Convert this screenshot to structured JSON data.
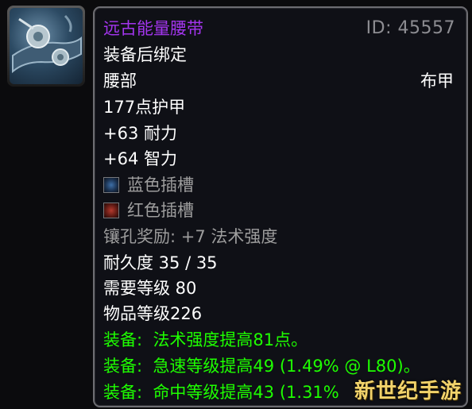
{
  "item": {
    "name": "远古能量腰带",
    "id_text": "ID: 45557",
    "binding": "装备后绑定",
    "slot": "腰部",
    "armor_type": "布甲",
    "armor": "177点护甲",
    "stats": [
      "+63 耐力",
      "+64 智力"
    ],
    "sockets": [
      {
        "color": "blue",
        "label": "蓝色插槽"
      },
      {
        "color": "red",
        "label": "红色插槽"
      }
    ],
    "socket_bonus": "镶孔奖励: +7 法术强度",
    "durability": "耐久度 35 / 35",
    "required_level": "需要等级 80",
    "item_level": "物品等级226",
    "equip_effects": [
      {
        "prefix": "装备:",
        "text": "法术强度提高81点。"
      },
      {
        "prefix": "装备:",
        "text": "急速等级提高49 (1.49% @ L80)。"
      },
      {
        "prefix": "装备:",
        "text": "命中等级提高43 (1.31%"
      }
    ]
  },
  "watermark": "新世纪手游",
  "colors": {
    "epic": "#a335ee",
    "green": "#1eff00",
    "gray": "#9d9d9d",
    "id_gray": "#8d8d92",
    "white": "#ffffff",
    "background": "#0f1016"
  },
  "icons": {
    "item_icon": "belt-icon",
    "socket_blue": "blue-socket-icon",
    "socket_red": "red-socket-icon"
  }
}
